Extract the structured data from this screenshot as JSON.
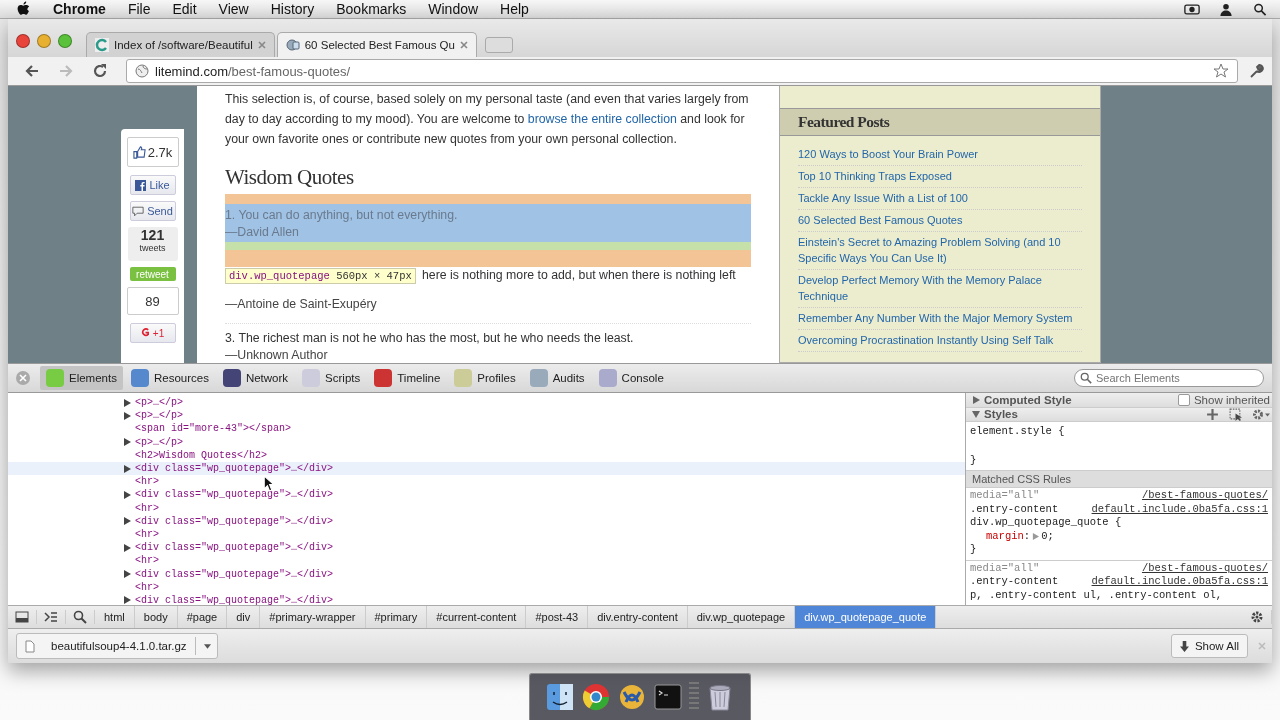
{
  "menubar": {
    "items": [
      {
        "label": "Chrome",
        "app": true
      },
      {
        "label": "File",
        "app": false
      },
      {
        "label": "Edit",
        "app": false
      },
      {
        "label": "View",
        "app": false
      },
      {
        "label": "History",
        "app": false
      },
      {
        "label": "Bookmarks",
        "app": false
      },
      {
        "label": "Window",
        "app": false
      },
      {
        "label": "Help",
        "app": false
      }
    ]
  },
  "tabs": [
    {
      "title": "Index of /software/Beautiful",
      "selected": false
    },
    {
      "title": "60 Selected Best Famous Qu",
      "selected": true
    }
  ],
  "address": {
    "domain": "litemind.com",
    "path": "/best-famous-quotes/"
  },
  "share": {
    "likes": "2.7k",
    "like": "Like",
    "send": "Send",
    "tweets_count": "121",
    "tweets_label": "tweets",
    "retweet": "retweet",
    "plus_count": "89",
    "plus_one": "+1"
  },
  "article": {
    "intro": "This selection is, of course, based solely on my personal taste (and even that varies largely from day to day according to my mood). You are welcome to ",
    "intro_link": "browse the entire collection",
    "intro_end": " and look for your own favorite ones or contribute new quotes from your own personal collection.",
    "heading": "Wisdom Quotes",
    "quotes": [
      {
        "text": "1. You can do anything, but not everything.",
        "author": "—David Allen",
        "highlighted": true
      },
      {
        "text": "here is nothing more to add, but when there is nothing left",
        "author": "—Antoine de Saint-Exupéry",
        "highlighted": false
      },
      {
        "text": "3. The richest man is not he who has the most, but he who needs the least.",
        "author": "—Unknown Author",
        "highlighted": false
      }
    ],
    "tooltip": {
      "selector": "div.wp_quotepage",
      "size": "560px × 47px"
    }
  },
  "sidebar": {
    "title": "Featured Posts",
    "links": [
      "120 Ways to Boost Your Brain Power",
      "Top 10 Thinking Traps Exposed",
      "Tackle Any Issue With a List of 100",
      "60 Selected Best Famous Quotes",
      "Einstein's Secret to Amazing Problem Solving (and 10 Specific Ways You Can Use It)",
      "Develop Perfect Memory With the Memory Palace Technique",
      "Remember Any Number With the Major Memory System",
      "Overcoming Procrastination Instantly Using Self Talk"
    ]
  },
  "devtools": {
    "tabs": [
      {
        "label": "Elements",
        "selected": true
      },
      {
        "label": "Resources",
        "selected": false
      },
      {
        "label": "Network",
        "selected": false
      },
      {
        "label": "Scripts",
        "selected": false
      },
      {
        "label": "Timeline",
        "selected": false
      },
      {
        "label": "Profiles",
        "selected": false
      },
      {
        "label": "Audits",
        "selected": false
      },
      {
        "label": "Console",
        "selected": false
      }
    ],
    "search": {
      "placeholder": "Search Elements"
    },
    "dom": [
      {
        "text": "<p>…</p>",
        "expandable": true,
        "hovered": false
      },
      {
        "text": "<p>…</p>",
        "expandable": true,
        "hovered": false
      },
      {
        "text": "<span id=\"more-43\"></span>",
        "expandable": false,
        "hovered": false
      },
      {
        "text": "<p>…</p>",
        "expandable": true,
        "hovered": false
      },
      {
        "text": "<h2>Wisdom Quotes</h2>",
        "expandable": false,
        "hovered": false
      },
      {
        "text": "<div class=\"wp_quotepage\">…</div>",
        "expandable": true,
        "hovered": true
      },
      {
        "text": "<hr>",
        "expandable": false,
        "hovered": false
      },
      {
        "text": "<div class=\"wp_quotepage\">…</div>",
        "expandable": true,
        "hovered": false
      },
      {
        "text": "<hr>",
        "expandable": false,
        "hovered": false
      },
      {
        "text": "<div class=\"wp_quotepage\">…</div>",
        "expandable": true,
        "hovered": false
      },
      {
        "text": "<hr>",
        "expandable": false,
        "hovered": false
      },
      {
        "text": "<div class=\"wp_quotepage\">…</div>",
        "expandable": true,
        "hovered": false
      },
      {
        "text": "<hr>",
        "expandable": false,
        "hovered": false
      },
      {
        "text": "<div class=\"wp_quotepage\">…</div>",
        "expandable": true,
        "hovered": false
      },
      {
        "text": "<hr>",
        "expandable": false,
        "hovered": false
      },
      {
        "text": "<div class=\"wp_quotepage\">…</div>",
        "expandable": true,
        "hovered": false
      }
    ],
    "computed": {
      "title": "Computed Style",
      "expanded": false,
      "show_inherited": {
        "label": "Show inherited",
        "checked": false
      }
    },
    "styles": {
      "title": "Styles",
      "expanded": true,
      "element_open": "element.style {",
      "element_close": "}",
      "matched_title": "Matched CSS Rules",
      "rules": [
        {
          "media": "media=\"all\"",
          "source": "/best-famous-quotes/",
          "file": "default.include.0ba5fa.css:1",
          "selector_lines": [
            ".entry-content",
            "div.wp_quotepage_quote {"
          ],
          "declarations": [
            {
              "property": "margin",
              "separator": ":",
              "value": "0;"
            }
          ],
          "closing": "}"
        },
        {
          "media": "media=\"all\"",
          "source": "/best-famous-quotes/",
          "file": "default.include.0ba5fa.css:1",
          "selector_lines": [
            ".entry-content",
            "p, .entry-content ul, .entry-content ol,"
          ]
        }
      ]
    },
    "breadcrumbs": [
      {
        "label": "html",
        "selected": false
      },
      {
        "label": "body",
        "selected": false
      },
      {
        "label": "#page",
        "selected": false
      },
      {
        "label": "div",
        "selected": false
      },
      {
        "label": "#primary-wrapper",
        "selected": false
      },
      {
        "label": "#primary",
        "selected": false
      },
      {
        "label": "#current-content",
        "selected": false
      },
      {
        "label": "#post-43",
        "selected": false
      },
      {
        "label": "div.entry-content",
        "selected": false
      },
      {
        "label": "div.wp_quotepage",
        "selected": false
      },
      {
        "label": "div.wp_quotepage_quote",
        "selected": true
      }
    ]
  },
  "downloads": {
    "file": "beautifulsoup4-4.1.0.tar.gz",
    "show_all": "Show All"
  }
}
